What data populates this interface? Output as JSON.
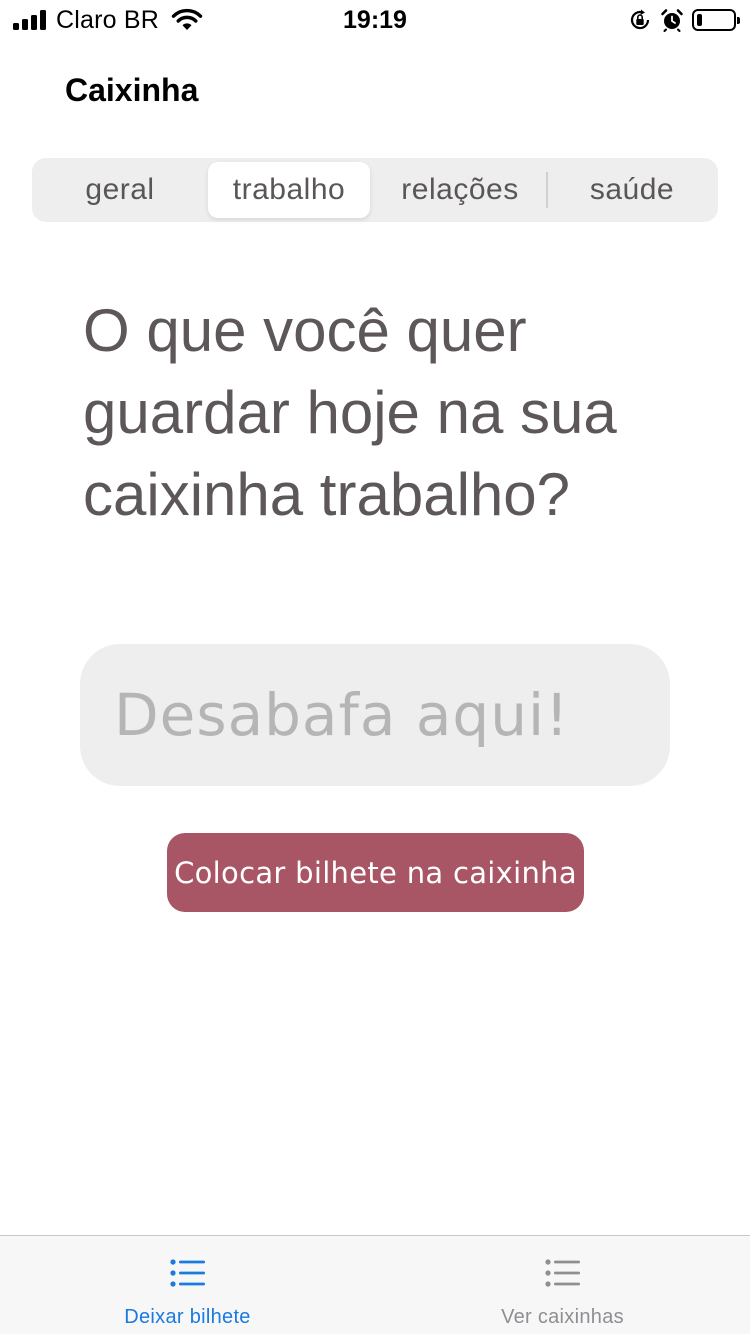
{
  "status_bar": {
    "carrier": "Claro BR",
    "time": "19:19",
    "icons": [
      "signal-icon",
      "wifi-icon",
      "orientation-lock-icon",
      "alarm-icon",
      "battery-icon"
    ],
    "battery_level": 0.15
  },
  "nav": {
    "title": "Caixinha"
  },
  "segments": {
    "items": [
      {
        "label": "geral"
      },
      {
        "label": "trabalho"
      },
      {
        "label": "relações"
      },
      {
        "label": "saúde"
      }
    ],
    "selected": "trabalho"
  },
  "main": {
    "question": "O que você quer guardar hoje na sua caixinha trabalho?",
    "input": {
      "value": "",
      "placeholder": "Desabafa aqui!"
    },
    "submit_label": "Colocar bilhete na caixinha"
  },
  "tab_bar": {
    "tabs": [
      {
        "label": "Deixar bilhete",
        "icon": "list-icon"
      },
      {
        "label": "Ver caixinhas",
        "icon": "list-icon"
      }
    ],
    "selected": "Deixar bilhete"
  },
  "colors": {
    "accent_blue": "#1a7ae0",
    "button": "#a85565",
    "text_gray": "#5d5759",
    "segment_bg": "#eeeeef",
    "input_bg": "#eeeeee"
  }
}
